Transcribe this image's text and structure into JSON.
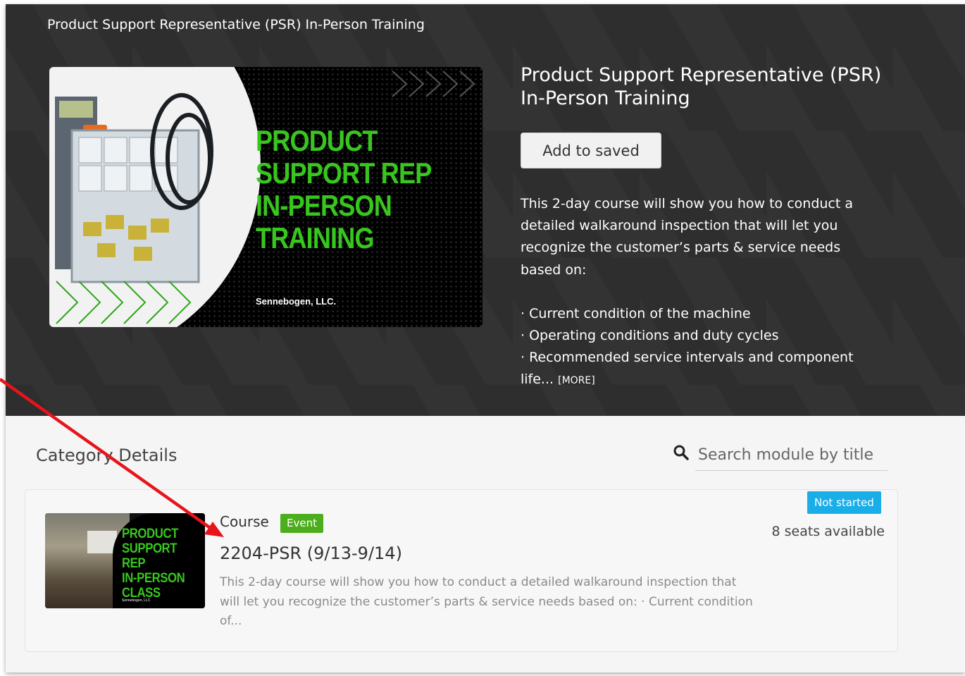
{
  "hero": {
    "breadcrumb": "Product Support Representative (PSR) In-Person Training",
    "image": {
      "title": "PRODUCT\nSUPPORT REP\nIN-PERSON\nTRAINING",
      "company": "Sennebogen, LLC."
    },
    "title": "Product Support Representative (PSR) In-Person Training",
    "save_button": "Add to saved",
    "description_intro": "This 2-day course will show you how to conduct a detailed walkaround inspection that will let you recognize the customer’s parts & service needs based on:",
    "bullets": [
      "· Current condition of the machine",
      "· Operating conditions and duty cycles",
      "· Recommended service intervals and component life..."
    ],
    "more_link": "[MORE]"
  },
  "category": {
    "title": "Category Details",
    "search_placeholder": "Search module by title"
  },
  "module": {
    "thumb_title": "PRODUCT\nSUPPORT REP\nIN-PERSON\nCLASS",
    "thumb_company": "Sennebogen, LLC",
    "type": "Course",
    "badge": "Event",
    "title": "2204-PSR (9/13-9/14)",
    "description": "This 2-day course will show you how to conduct a detailed walkaround inspection that will let you recognize the customer’s parts & service needs based on: · Current condition of...",
    "status": "Not started",
    "seats": "8 seats available"
  },
  "colors": {
    "hero_bg": "#2e2e2e",
    "brand_green": "#38c61e",
    "badge_green": "#4cae1e",
    "status_blue": "#19aee8",
    "annotation_arrow": "#e8141c"
  }
}
